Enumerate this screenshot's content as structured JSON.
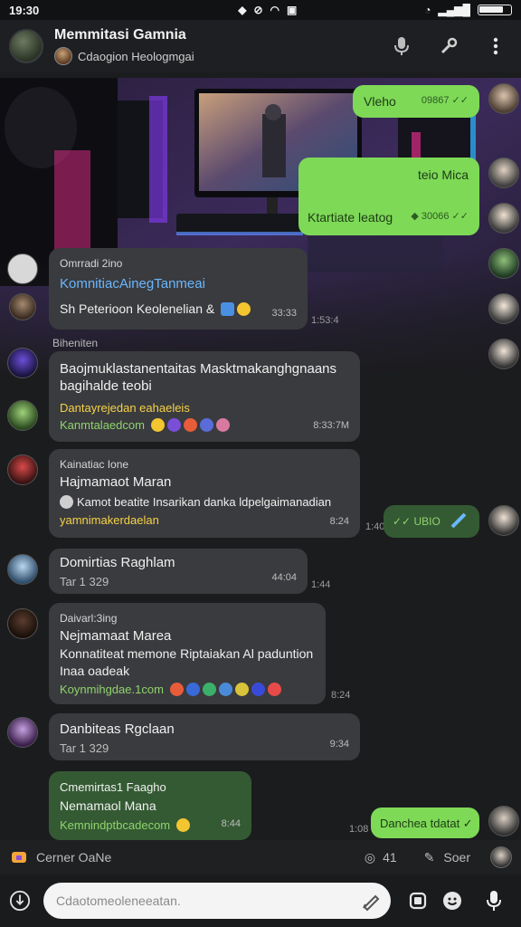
{
  "status": {
    "time": "19:30"
  },
  "header": {
    "title": "Memmitasi Gamnia",
    "subtitle": "Cdaogion Heologmgai"
  },
  "messages": {
    "m1": {
      "text": "Vleho",
      "time": "09867"
    },
    "m2": {
      "text": "teio Mica",
      "text2": "Ktartiate leatog",
      "time": "30066"
    },
    "m3": {
      "sender": "Omrradi 2ino",
      "link": "KomnitiacAinegTanmeai",
      "line2": "Sh Peterioon Keolenelian &",
      "time": "33:33",
      "side": "1:53:4"
    },
    "sect": "Biheniten",
    "m4": {
      "line1": "Baojmuklastanentaitas Masktmakanghgnaans",
      "line2": "bagihalde teobi",
      "line3": "Dantayrejedan eahaeleis",
      "link": "Kanmtalaedcom",
      "time": "8:33:7M"
    },
    "m5": {
      "sender": "Kainatiac Ione",
      "line1": "Hajmamaot Maran",
      "line2": "Kamot beatite Insarikan danka ldpelgaimanadian",
      "line3": "yamnimakerdaelan",
      "time": "8:24",
      "side": "1:0:4"
    },
    "m5out": {
      "text": "UBIO",
      "side": "1:40"
    },
    "m6": {
      "title": "Domirtias Raghlam",
      "sub": "Tar 1 329",
      "time": "44:04",
      "side": "1:44"
    },
    "m7": {
      "sender": "Daivarl:3ing",
      "line1": "Nejmamaat Marea",
      "line2": "Konnatiteat memone Riptaiakan Al paduntion",
      "line3": "Inaa oadeak",
      "link": "Koynmihgdae.1com",
      "side": "8:24"
    },
    "m8": {
      "title": "Danbiteas Rgclaan",
      "sub": "Tar 1 329",
      "time": "9:34"
    },
    "m9": {
      "sender": "Cmemirtas1 Faagho",
      "line1": "Nemamaol Mana",
      "link": "Kemnindptbcadecom",
      "time": "8:44"
    },
    "m9out": {
      "text": "Danchea tdatat",
      "side": "1:08"
    }
  },
  "composer": {
    "label": "Cerner OaNe",
    "count": "41",
    "send_label": "Soer",
    "placeholder": "Cdaotomeoleneeatan."
  },
  "colors": {
    "accent": "#7ed957",
    "background": "#1b1c1e",
    "bubble_in": "#3a3b3e"
  }
}
